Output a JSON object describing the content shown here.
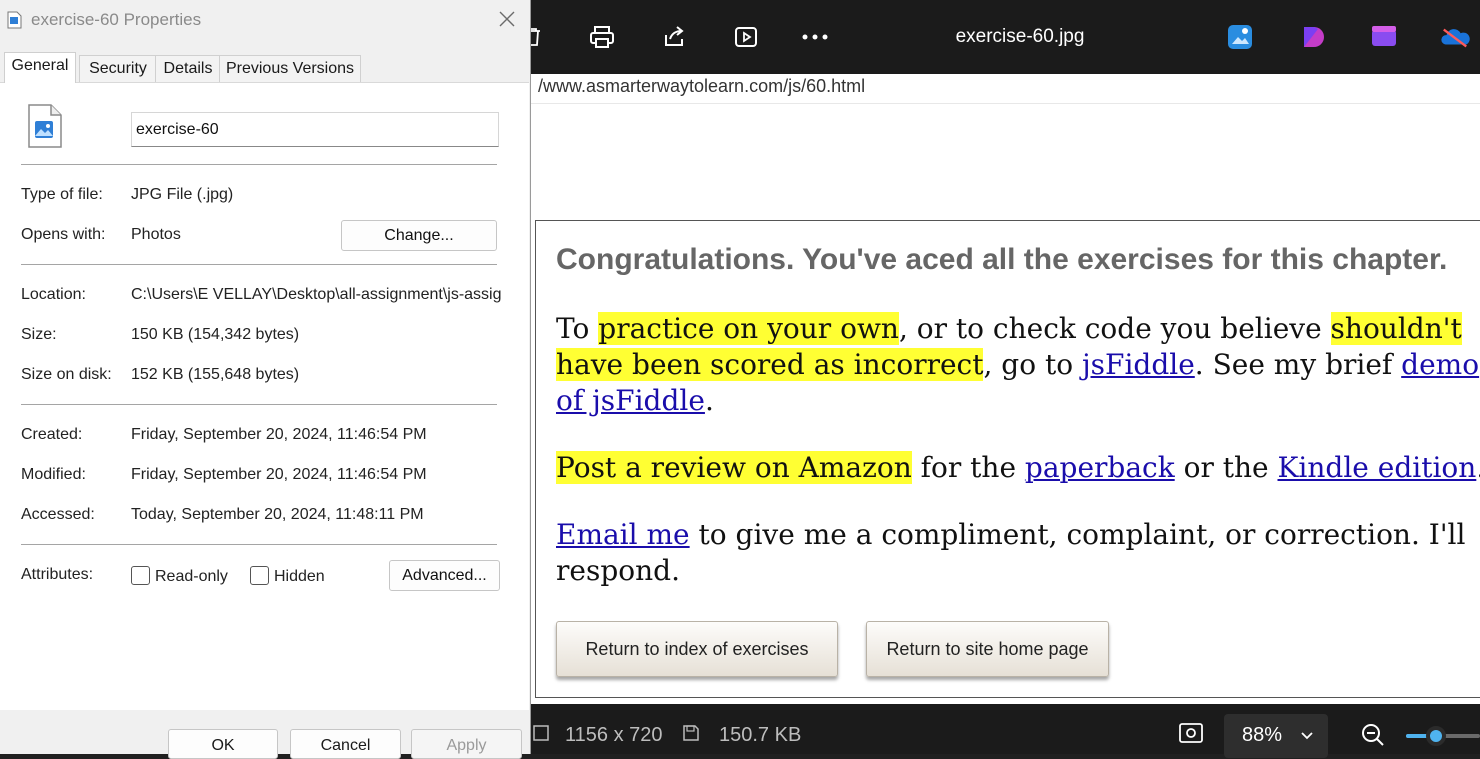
{
  "viewer": {
    "title": "exercise-60.jpg",
    "toolbar_icons": [
      "delete-icon",
      "print-icon",
      "share-icon",
      "slideshow-icon",
      "more-icon"
    ],
    "app_icons": [
      "designer-icon",
      "clipchamp-icon",
      "video-editor-icon",
      "onedrive-icon"
    ],
    "url_text": "/www.asmarterwaytolearn.com/js/60.html",
    "page": {
      "heading": "Congratulations. You've aced all the exercises for this chapter.",
      "p1": {
        "t1": "To ",
        "h1": "practice on your own",
        "t2": ", or to check code you believe ",
        "h2": "shouldn't have been scored as incorrect",
        "t3": ", go to ",
        "l1": "jsFiddle",
        "t4": ". See my brief ",
        "l2": "demo of jsFiddle",
        "t5": "."
      },
      "p2": {
        "h1": "Post a review on Amazon",
        "t1": " for the ",
        "l1": "paperback",
        "t2": " or the ",
        "l2": "Kindle edition",
        "t3": "."
      },
      "p3": {
        "l1": "Email me",
        "t1": " to give me a compliment, complaint, or correction. I'll respond."
      },
      "btn_index": "Return to index of exercises",
      "btn_home": "Return to site home page"
    },
    "status": {
      "dimensions": "1156 x 720",
      "filesize": "150.7 KB",
      "zoom": "88%"
    }
  },
  "dialog": {
    "title": "exercise-60 Properties",
    "tabs": [
      "General",
      "Security",
      "Details",
      "Previous Versions"
    ],
    "filename": "exercise-60",
    "rows": {
      "type_label": "Type of file:",
      "type_value": "JPG File (.jpg)",
      "opens_label": "Opens with:",
      "opens_value": "Photos",
      "location_label": "Location:",
      "location_value": "C:\\Users\\E VELLAY\\Desktop\\all-assignment\\js-assig",
      "size_label": "Size:",
      "size_value": "150 KB (154,342 bytes)",
      "disk_label": "Size on disk:",
      "disk_value": "152 KB (155,648 bytes)",
      "created_label": "Created:",
      "created_value": "Friday, September 20, 2024, 11:46:54 PM",
      "modified_label": "Modified:",
      "modified_value": "Friday, September 20, 2024, 11:46:54 PM",
      "accessed_label": "Accessed:",
      "accessed_value": "Today, September 20, 2024, 11:48:11 PM",
      "attr_label": "Attributes:"
    },
    "change_button": "Change...",
    "readonly_label": "Read-only",
    "hidden_label": "Hidden",
    "advanced_button": "Advanced...",
    "ok_button": "OK",
    "cancel_button": "Cancel",
    "apply_button": "Apply"
  }
}
